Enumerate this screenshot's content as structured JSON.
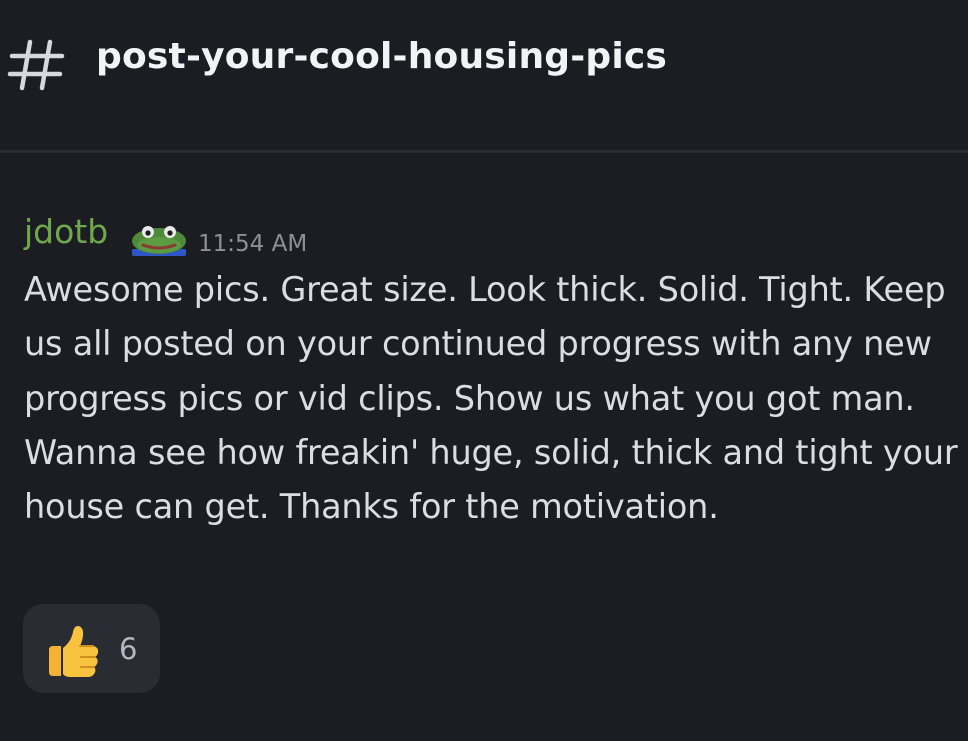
{
  "channel": {
    "icon": "hash-icon",
    "name": "post-your-cool-housing-pics"
  },
  "message": {
    "author": "jdotb",
    "author_color": "#6fa84a",
    "badge_icon": "frog-emoji-icon",
    "timestamp": "11:54 AM",
    "text": "Awesome pics. Great size. Look thick. Solid. Tight. Keep us all posted on your continued progress with any new progress pics or vid clips. Show us what you got man. Wanna see how freakin' huge, solid, thick and tight your house can get. Thanks for the motivation."
  },
  "reactions": [
    {
      "emoji": "thumbs-up-icon",
      "count": "6"
    }
  ],
  "colors": {
    "background": "#1c1d22",
    "divider": "#2a2b33",
    "reaction_bg": "#2a2c33"
  }
}
